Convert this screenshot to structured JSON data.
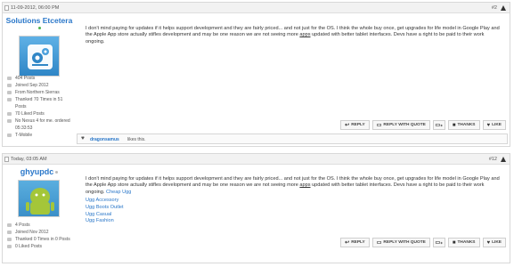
{
  "posts": [
    {
      "date": "11-09-2012, 06:00 PM",
      "number": "#2",
      "username": "Solutions Etcetera",
      "stats": [
        "404 Posts",
        "Joined Sep 2012",
        "From Northern Sierras",
        "Thanked 70 Times in 51 Posts",
        "70 Liked Posts",
        "No Nexus 4 for me. ordered 05:33:53",
        "T-Mobile"
      ],
      "body": "I don't mind paying for updates if it helps support development and they are fairly priced... and not just for the OS. I think the whole buy once, get upgrades for life model in Google Play and the Apple App store actually stifles development and may be one reason we are not seeing more apps updated with better tablet interfaces. Devs have a right to be paid to their work ongoing.",
      "actions": [
        "REPLY",
        "REPLY WITH QUOTE",
        "THANKS",
        "LIKE"
      ],
      "likes": {
        "user": "dragonsamus",
        "text": "likes this."
      }
    },
    {
      "date": "Today, 03:05 AM",
      "number": "#12",
      "username": "ghyupdc",
      "stats": [
        "4 Posts",
        "Joined Nov 2012",
        "Thanked 0 Times in 0 Posts",
        "0 Liked Posts"
      ],
      "body": "I don't mind paying for updates if it helps support development and they are fairly priced... and not just for the OS. I think the whole buy once, get upgrades for life model in Google Play and the Apple App store actually stifles development and may be one reason we are not seeing more apps updated with better tablet interfaces. Devs have a right to be paid to their work ongoing.",
      "inline_link": "Cheap Ugg",
      "links": [
        "Ugg Accessory",
        "Ugg Boots Outlet",
        "Ugg Casual",
        "Ugg Fashion"
      ],
      "actions": [
        "REPLY",
        "REPLY WITH QUOTE",
        "THANKS",
        "LIKE"
      ]
    }
  ]
}
